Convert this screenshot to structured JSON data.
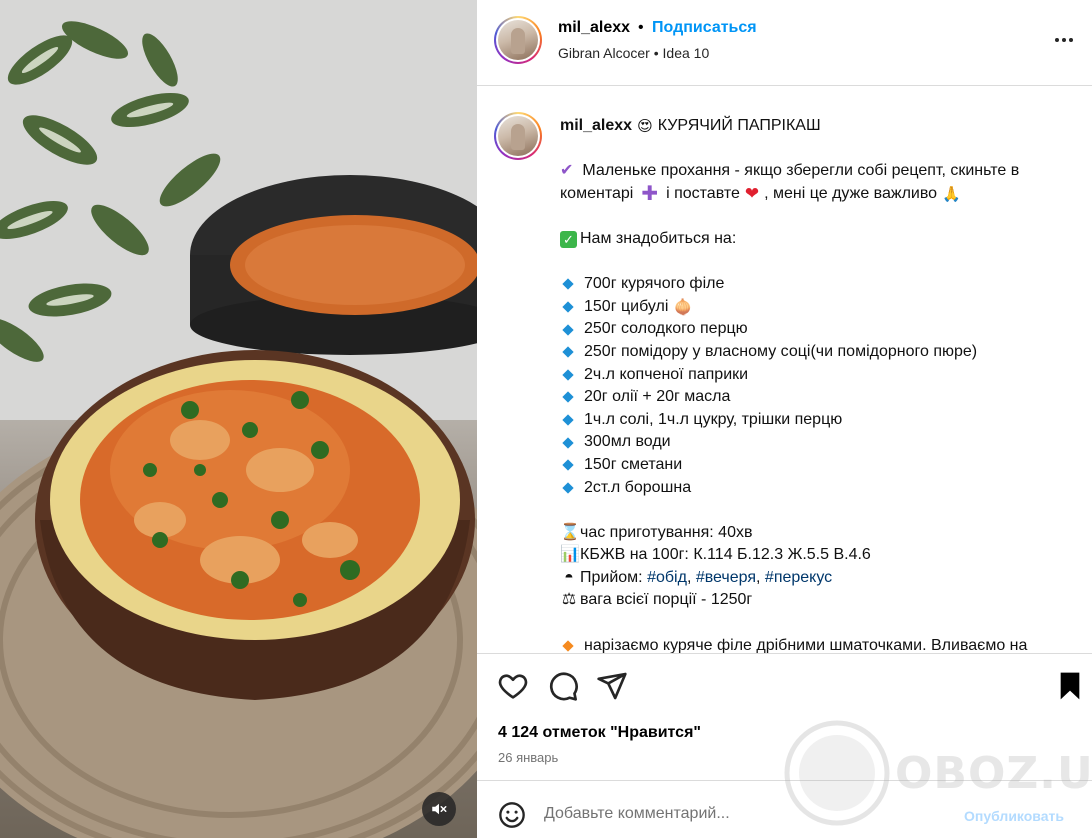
{
  "post": {
    "username": "mil_alexx",
    "separator": "•",
    "follow_label": "Подписаться",
    "audio_artist": "Gibran Alcocer",
    "audio_track": "Idea 10"
  },
  "caption": {
    "username": "mil_alexx",
    "title": "КУРЯЧИЙ ПАПРІКАШ",
    "request_line1": "Маленьке прохання - якщо зберегли собі рецепт, скиньте в",
    "request_line2a": "коментарі",
    "request_line2b": "і поставте",
    "request_line2c": ", мені це дуже важливо",
    "need_label": "Нам знадобиться на:",
    "ingredients": [
      "700г курячого філе",
      " 150г цибулі",
      " 250г солодкого перцю",
      " 250г помідору у власному соці(чи помідорного пюре)",
      " 2ч.л копченої паприки",
      " 20г олії + 20г масла",
      "1ч.л солі, 1ч.л цукру, трішки перцю",
      "300мл води",
      " 150г сметани",
      "2ст.л борошна"
    ],
    "time": "час приготування: 40хв",
    "kbzhv": "КБЖВ на 100г: К.114 Б.12.3 Ж.5.5 В.4.6",
    "meal_label": "Прийом:",
    "tags": [
      "#обід",
      "#вечеря",
      "#перекус"
    ],
    "weight": "вага всієї порції - 1250г",
    "step1": "нарізаємо куряче філе дрібними шматочками. Вливаємо на"
  },
  "actions": {
    "likes": "4 124 отметок \"Нравится\"",
    "date": "26 январь"
  },
  "comment": {
    "placeholder": "Добавьте комментарий...",
    "publish_label": "Опубликовать"
  },
  "watermark": {
    "text": "OBOZ.UA"
  },
  "icons": {
    "like": "heart-outline-icon",
    "comment": "comment-bubble-icon",
    "share": "paper-plane-icon",
    "save": "bookmark-filled-icon",
    "mute": "speaker-muted-icon",
    "emoji": "smiley-icon",
    "more": "ellipsis-icon"
  },
  "colors": {
    "accent": "#0095f6",
    "tag": "#00376b",
    "bullet": "#1e90d6",
    "publish_disabled": "#b3dbff"
  }
}
